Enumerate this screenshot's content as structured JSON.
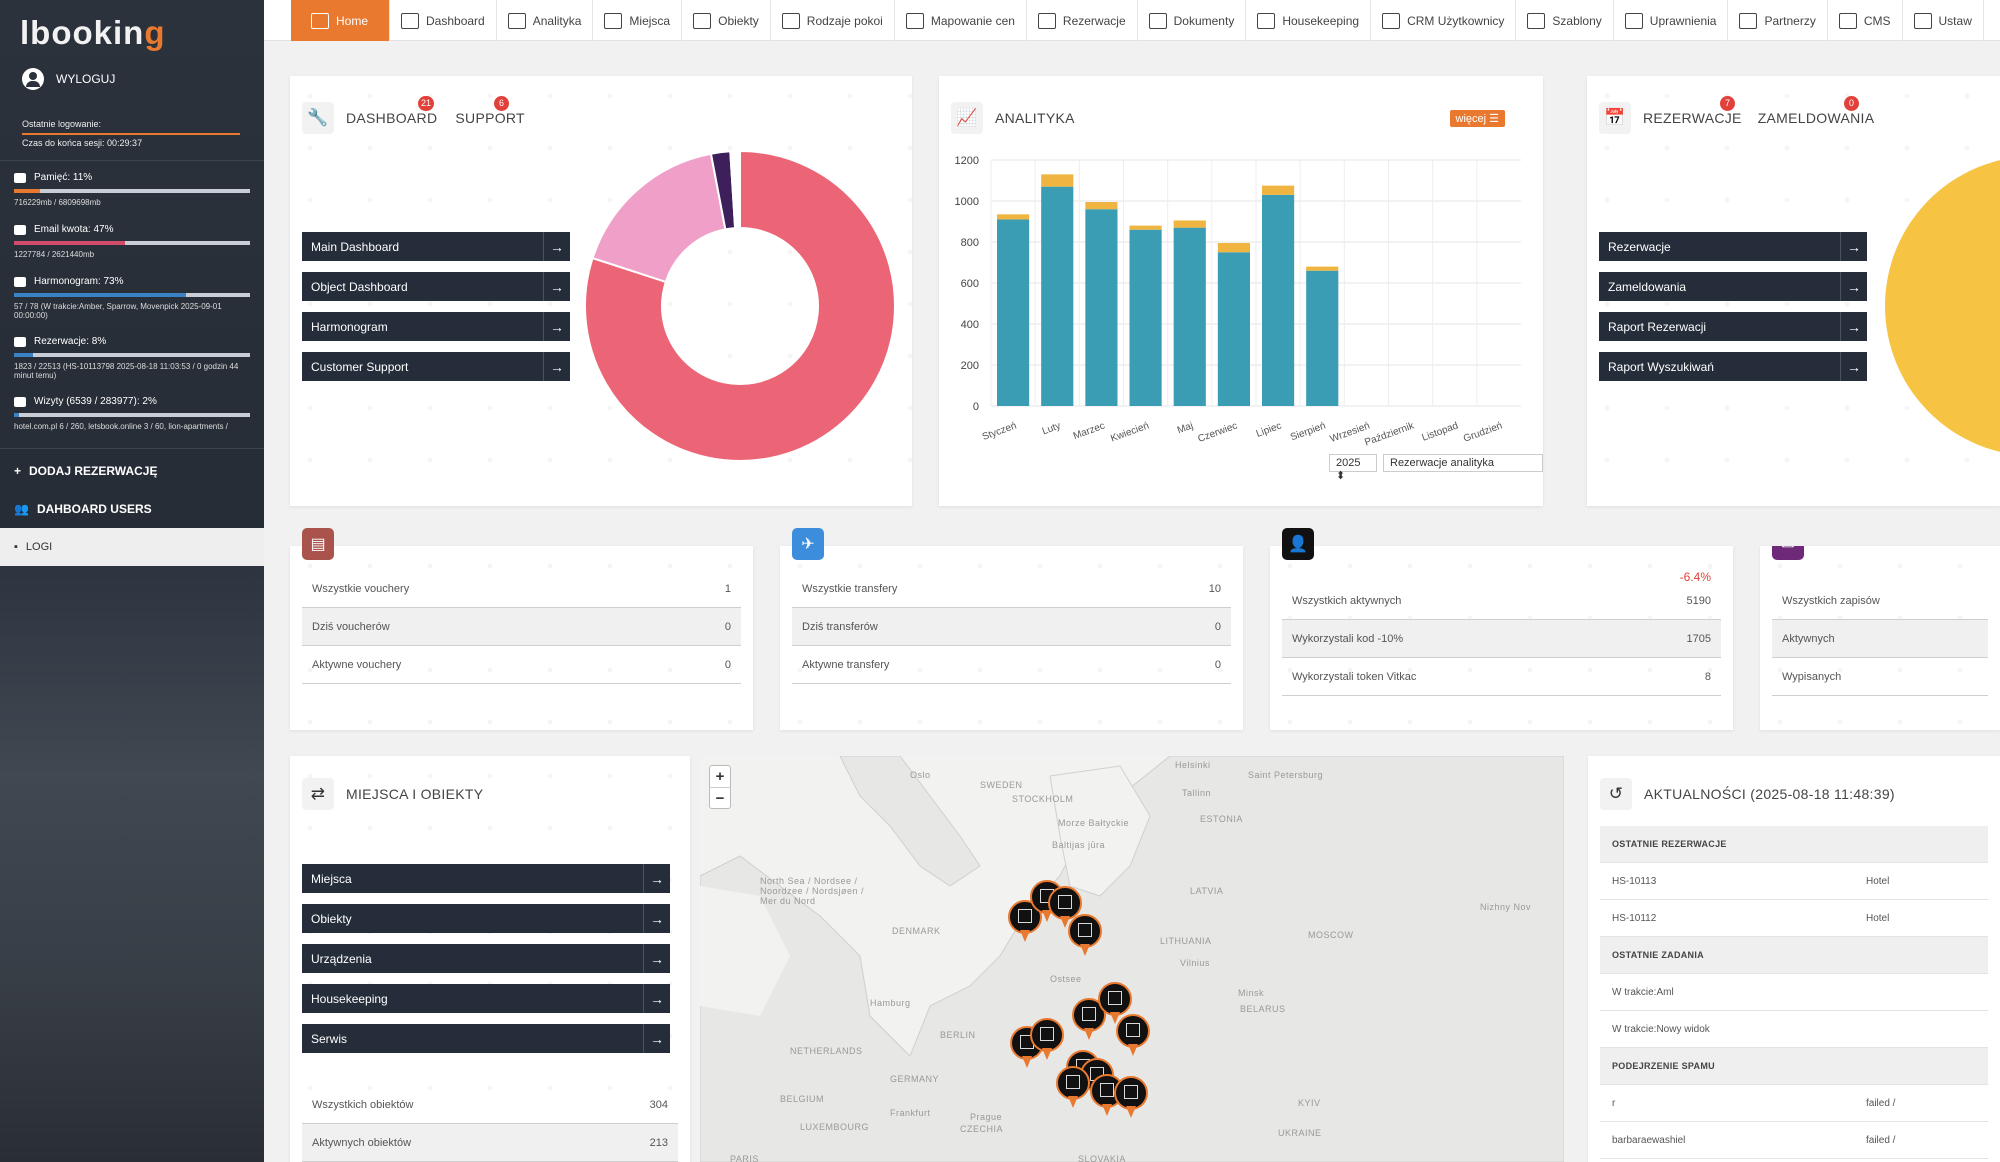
{
  "brand": {
    "logo_main": "lbookin",
    "logo_accent": "g"
  },
  "sidebar": {
    "logout": "WYLOGUJ",
    "last_login_label": "Ostatnie logowanie:",
    "session_left": "Czas do końca sesji: 00:29:37",
    "stats": [
      {
        "label": "Pamięć: 11%",
        "sub": "716229mb / 6809698mb",
        "fraction": 0.11,
        "color": "#e8792f"
      },
      {
        "label": "Email kwota: 47%",
        "sub": "1227784 / 2621440mb",
        "fraction": 0.47,
        "color": "#d24b6a"
      },
      {
        "label": "Harmonogram: 73%",
        "sub": "57 / 78 (W trakcie:Amber, Sparrow, Movenpick 2025-09-01 00:00:00)",
        "fraction": 0.73,
        "color": "#3b82c4"
      },
      {
        "label": "Rezerwacje: 8%",
        "sub": "1823 / 22513 (HS-10113798 2025-08-18 11:03:53 / 0 godzin 44 minut temu)",
        "fraction": 0.08,
        "color": "#3b82c4"
      },
      {
        "label": "Wizyty (6539 / 283977): 2%",
        "sub": "hotel.com.pl 6 / 260, letsbook.online 3 / 60, lion-apartments /",
        "fraction": 0.02,
        "color": "#3b82c4"
      }
    ],
    "add_reservation": "DODAJ REZERWACJĘ",
    "dashboard_users": "DAHBOARD USERS",
    "logs": "LOGI"
  },
  "nav": [
    "Home",
    "Dashboard",
    "Analityka",
    "Miejsca",
    "Obiekty",
    "Rodzaje pokoi",
    "Mapowanie cen",
    "Rezerwacje",
    "Dokumenty",
    "Housekeeping",
    "CRM Użytkownicy",
    "Szablony",
    "Uprawnienia",
    "Partnerzy",
    "CMS",
    "Ustaw"
  ],
  "dashboard_card": {
    "title1": "DASHBOARD",
    "badge1": "21",
    "title2": "SUPPORT",
    "badge2": "6",
    "buttons": [
      "Main Dashboard",
      "Object Dashboard",
      "Harmonogram",
      "Customer Support"
    ]
  },
  "donut": {
    "values": [
      80,
      17,
      2,
      1
    ],
    "colors": [
      "#ec6577",
      "#f0a0c8",
      "#3d1f5c",
      "#ffffff"
    ]
  },
  "analytics_card": {
    "title": "ANALITYKA",
    "more": "więcej",
    "year": "2025",
    "select": "Rezerwacje analityka"
  },
  "chart_data": {
    "type": "bar",
    "categories": [
      "Styczeń",
      "Luty",
      "Marzec",
      "Kwiecień",
      "Maj",
      "Czerwiec",
      "Lipiec",
      "Sierpień",
      "Wrzesień",
      "Październik",
      "Listopad",
      "Grudzień"
    ],
    "series": [
      {
        "values": [
          910,
          1070,
          960,
          860,
          870,
          750,
          1030,
          660,
          0,
          0,
          0,
          0
        ],
        "color": "#3b9db4"
      },
      {
        "values": [
          25,
          60,
          35,
          20,
          35,
          45,
          45,
          20,
          0,
          0,
          0,
          0
        ],
        "color": "#f0b541"
      }
    ],
    "ylim": [
      0,
      1200
    ],
    "yticks": [
      0,
      200,
      400,
      600,
      800,
      1000,
      1200
    ]
  },
  "reservations_card": {
    "title1": "REZERWACJE",
    "badge1": "7",
    "title2": "ZAMELDOWANIA",
    "badge2": "0",
    "buttons": [
      "Rezerwacje",
      "Zameldowania",
      "Raport Rezerwacji",
      "Raport Wyszukiwań"
    ]
  },
  "vouchers": {
    "rows": [
      [
        "Wszystkie vouchery",
        "1"
      ],
      [
        "Dziś voucherów",
        "0"
      ],
      [
        "Aktywne vouchery",
        "0"
      ]
    ],
    "color": "#a9534c"
  },
  "transfers": {
    "rows": [
      [
        "Wszystkie transfery",
        "10"
      ],
      [
        "Dziś transferów",
        "0"
      ],
      [
        "Aktywne transfery",
        "0"
      ]
    ],
    "color": "#3c8ddb"
  },
  "users": {
    "change": "-6.4%",
    "rows": [
      [
        "Wszystkich aktywnych",
        "5190"
      ],
      [
        "Wykorzystali kod -10%",
        "1705"
      ],
      [
        "Wykorzystali token Vitkac",
        "8"
      ]
    ],
    "color": "#111111"
  },
  "newsletter": {
    "rows": [
      [
        "Wszystkich zapisów",
        ""
      ],
      [
        "Aktywnych",
        ""
      ],
      [
        "Wypisanych",
        ""
      ]
    ],
    "color": "#6e2a78"
  },
  "places_card": {
    "title": "MIEJSCA I OBIEKTY",
    "buttons": [
      "Miejsca",
      "Obiekty",
      "Urządzenia",
      "Housekeeping",
      "Serwis"
    ],
    "rows": [
      [
        "Wszystkich obiektów",
        "304"
      ],
      [
        "Aktywnych obiektów",
        "213"
      ]
    ]
  },
  "map": {
    "zoom_in": "+",
    "zoom_out": "−",
    "labels": [
      "Oslo",
      "SWEDEN",
      "STOCKHOLM",
      "Helsinki",
      "Saint Petersburg",
      "Tallinn",
      "ESTONIA",
      "Morze Bałtyckie",
      "Baltijas jūra",
      "North Sea / Nordsee / Noordzee / Nordsjøen / Mer du Nord",
      "DENMARK",
      "LATVIA",
      "LITHUANIA",
      "Vilnius",
      "MOSCOW",
      "Nizhny Nov",
      "Minsk",
      "BELARUS",
      "Hamburg",
      "BERLIN",
      "NETHERLANDS",
      "BELGIUM",
      "LUXEMBOURG",
      "GERMANY",
      "Frankfurt",
      "Prague",
      "CZECHIA",
      "KYIV",
      "UKRAINE",
      "SLOVAKIA",
      "PARIS",
      "Ostsee"
    ]
  },
  "news": {
    "title": "AKTUALNOŚCI (2025-08-18 11:48:39)",
    "rows": [
      {
        "type": "head",
        "a": "OSTATNIE REZERWACJE",
        "b": ""
      },
      {
        "type": "row",
        "a": "HS-10113",
        "b": "Hotel"
      },
      {
        "type": "row",
        "a": "HS-10112",
        "b": "Hotel"
      },
      {
        "type": "head",
        "a": "OSTATNIE ZADANIA",
        "b": ""
      },
      {
        "type": "row",
        "a": "W trakcie:Aml",
        "b": ""
      },
      {
        "type": "row",
        "a": "W trakcie:Nowy widok",
        "b": ""
      },
      {
        "type": "head",
        "a": "PODEJRZENIE SPAMU",
        "b": ""
      },
      {
        "type": "row",
        "a": "r",
        "b": "failed /"
      },
      {
        "type": "row",
        "a": "barbaraewashiel",
        "b": "failed /"
      }
    ]
  }
}
